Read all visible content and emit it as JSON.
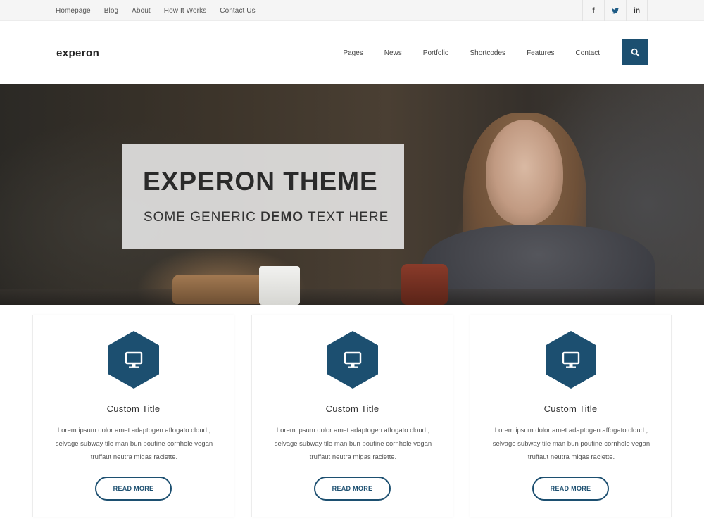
{
  "topbar": {
    "links": [
      "Homepage",
      "Blog",
      "About",
      "How It Works",
      "Contact Us"
    ],
    "social": [
      {
        "icon": "facebook-icon",
        "glyph": "f"
      },
      {
        "icon": "twitter-icon",
        "glyph": "🐦"
      },
      {
        "icon": "linkedin-icon",
        "glyph": "in"
      }
    ]
  },
  "header": {
    "logo": "experon",
    "nav": [
      "Pages",
      "News",
      "Portfolio",
      "Shortcodes",
      "Features",
      "Contact"
    ],
    "search_icon": "search-icon"
  },
  "hero": {
    "title": "EXPERON THEME",
    "subtitle_pre": "SOME GENERIC ",
    "subtitle_bold": "DEMO",
    "subtitle_post": " TEXT HERE"
  },
  "cards": [
    {
      "icon": "monitor-icon",
      "title": "Custom Title",
      "text": "Lorem ipsum dolor amet adaptogen affogato cloud , selvage subway tile man bun poutine cornhole vegan truffaut neutra migas raclette.",
      "button": "READ MORE"
    },
    {
      "icon": "monitor-icon",
      "title": "Custom Title",
      "text": "Lorem ipsum dolor amet adaptogen affogato cloud , selvage subway tile man bun poutine cornhole vegan truffaut neutra migas raclette.",
      "button": "READ MORE"
    },
    {
      "icon": "monitor-icon",
      "title": "Custom Title",
      "text": "Lorem ipsum dolor amet adaptogen affogato cloud , selvage subway tile man bun poutine cornhole vegan truffaut neutra migas raclette.",
      "button": "READ MORE"
    }
  ],
  "colors": {
    "accent": "#1c4f70",
    "topbar_bg": "#f5f5f5"
  }
}
